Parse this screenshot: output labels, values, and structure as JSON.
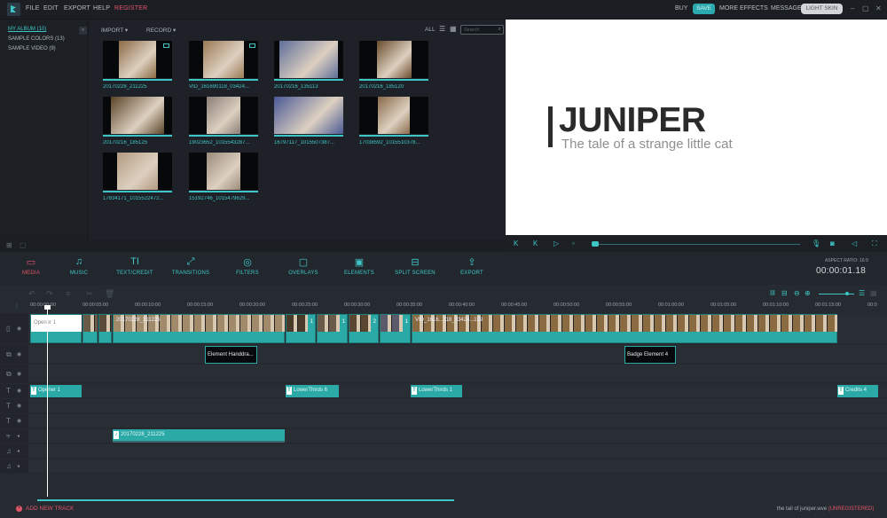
{
  "menu": {
    "items": [
      "FILE",
      "EDIT",
      "EXPORT",
      "HELP"
    ],
    "register": "REGISTER"
  },
  "topright": {
    "buy": "BUY",
    "save": "SAVE",
    "more_effects": "MORE EFFECTS",
    "message": "MESSAGE",
    "light_skin": "LIGHT SKIN",
    "minimize": "–",
    "maximize": "▢",
    "close": "✕"
  },
  "library": {
    "items": [
      {
        "label": "MY ALBUM (10)",
        "active": true
      },
      {
        "label": "SAMPLE COLORS (13)",
        "active": false
      },
      {
        "label": "SAMPLE VIDEO (9)",
        "active": false
      }
    ],
    "collapse_icon": "«"
  },
  "media_toolbar": {
    "import": "IMPORT ▾",
    "record": "RECORD ▾",
    "filter": "ALL",
    "search_placeholder": "Search"
  },
  "media_items": [
    {
      "name": "20170228_211225",
      "video": true,
      "color": "#8a6a44"
    },
    {
      "name": "VID_161690118_03424...",
      "video": true,
      "color": "#9a7a55"
    },
    {
      "name": "20170216_135113",
      "video": false,
      "color": "#5e6f9a"
    },
    {
      "name": "20170216_185120",
      "video": false,
      "color": "#6a4b2c"
    },
    {
      "name": "20170216_185125",
      "video": false,
      "color": "#5a4428"
    },
    {
      "name": "19023652_1015543287...",
      "video": false,
      "color": "#8a7e77"
    },
    {
      "name": "16797117_1015507387...",
      "video": false,
      "color": "#4a5a96"
    },
    {
      "name": "17038592_1015510378...",
      "video": false,
      "color": "#8a6a4a"
    },
    {
      "name": "17834171_1015522472...",
      "video": false,
      "color": "#b29a80"
    },
    {
      "name": "15192746_1015479629...",
      "video": false,
      "color": "#9a8a7a"
    }
  ],
  "preview": {
    "title": "JUNIPER",
    "subtitle": "The tale of a strange little cat",
    "progress": 0.01
  },
  "tabs": [
    {
      "label": "MEDIA",
      "icon": "▭",
      "active": true
    },
    {
      "label": "MUSIC",
      "icon": "♫",
      "active": false
    },
    {
      "label": "TEXT/CREDIT",
      "icon": "TI",
      "active": false
    },
    {
      "label": "TRANSITIONS",
      "icon": "⤢",
      "active": false
    },
    {
      "label": "FILTERS",
      "icon": "◎",
      "active": false
    },
    {
      "label": "OVERLAYS",
      "icon": "▢",
      "active": false
    },
    {
      "label": "ELEMENTS",
      "icon": "▣",
      "active": false
    },
    {
      "label": "SPLIT SCREEN",
      "icon": "⊟",
      "active": false
    },
    {
      "label": "EXPORT",
      "icon": "⇪",
      "active": false
    }
  ],
  "aspect_ratio": "ASPECT RATIO: 16:9",
  "timecode": "00:00:01.18",
  "ruler": [
    "00:00:00:00",
    "00:00:05:00",
    "00:00:10:00",
    "00:00:15:00",
    "00:00:20:00",
    "00:00:25:00",
    "00:00:30:00",
    "00:00:35:00",
    "00:00:40:00",
    "00:00:45:00",
    "00:00:50:00",
    "00:00:55:00",
    "00:01:00:00",
    "00:01:05:00",
    "00:01:10:00",
    "00:01:15:00",
    "00:0"
  ],
  "clips": {
    "opener": "Opener 1",
    "video1": "20170228_211225",
    "video2": "VID_1616...118_03424...199",
    "markers": [
      "1",
      "1",
      "2",
      "1"
    ],
    "element1": "Element Handdra...",
    "element2": "Badge Element 4",
    "text": [
      "Opener 1",
      "LowerThirds 6",
      "LowerThirds 1",
      "Credits 4"
    ],
    "audio": "20170228_211225"
  },
  "timeline_zoom": 0.8,
  "footer": {
    "add_track": "ADD NEW TRACK",
    "filename": "the tail of juniper.wve",
    "unregistered": "(UNREGISTERED)"
  }
}
